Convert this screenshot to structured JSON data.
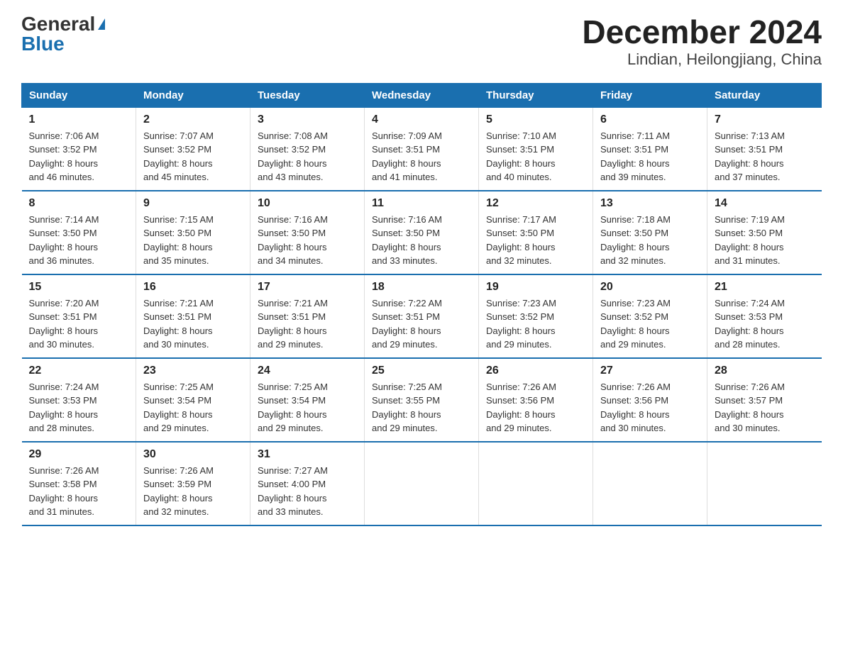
{
  "logo": {
    "general": "General",
    "blue": "Blue",
    "triangle": true
  },
  "title": "December 2024",
  "subtitle": "Lindian, Heilongjiang, China",
  "days_header": [
    "Sunday",
    "Monday",
    "Tuesday",
    "Wednesday",
    "Thursday",
    "Friday",
    "Saturday"
  ],
  "weeks": [
    [
      {
        "num": "1",
        "info": "Sunrise: 7:06 AM\nSunset: 3:52 PM\nDaylight: 8 hours\nand 46 minutes."
      },
      {
        "num": "2",
        "info": "Sunrise: 7:07 AM\nSunset: 3:52 PM\nDaylight: 8 hours\nand 45 minutes."
      },
      {
        "num": "3",
        "info": "Sunrise: 7:08 AM\nSunset: 3:52 PM\nDaylight: 8 hours\nand 43 minutes."
      },
      {
        "num": "4",
        "info": "Sunrise: 7:09 AM\nSunset: 3:51 PM\nDaylight: 8 hours\nand 41 minutes."
      },
      {
        "num": "5",
        "info": "Sunrise: 7:10 AM\nSunset: 3:51 PM\nDaylight: 8 hours\nand 40 minutes."
      },
      {
        "num": "6",
        "info": "Sunrise: 7:11 AM\nSunset: 3:51 PM\nDaylight: 8 hours\nand 39 minutes."
      },
      {
        "num": "7",
        "info": "Sunrise: 7:13 AM\nSunset: 3:51 PM\nDaylight: 8 hours\nand 37 minutes."
      }
    ],
    [
      {
        "num": "8",
        "info": "Sunrise: 7:14 AM\nSunset: 3:50 PM\nDaylight: 8 hours\nand 36 minutes."
      },
      {
        "num": "9",
        "info": "Sunrise: 7:15 AM\nSunset: 3:50 PM\nDaylight: 8 hours\nand 35 minutes."
      },
      {
        "num": "10",
        "info": "Sunrise: 7:16 AM\nSunset: 3:50 PM\nDaylight: 8 hours\nand 34 minutes."
      },
      {
        "num": "11",
        "info": "Sunrise: 7:16 AM\nSunset: 3:50 PM\nDaylight: 8 hours\nand 33 minutes."
      },
      {
        "num": "12",
        "info": "Sunrise: 7:17 AM\nSunset: 3:50 PM\nDaylight: 8 hours\nand 32 minutes."
      },
      {
        "num": "13",
        "info": "Sunrise: 7:18 AM\nSunset: 3:50 PM\nDaylight: 8 hours\nand 32 minutes."
      },
      {
        "num": "14",
        "info": "Sunrise: 7:19 AM\nSunset: 3:50 PM\nDaylight: 8 hours\nand 31 minutes."
      }
    ],
    [
      {
        "num": "15",
        "info": "Sunrise: 7:20 AM\nSunset: 3:51 PM\nDaylight: 8 hours\nand 30 minutes."
      },
      {
        "num": "16",
        "info": "Sunrise: 7:21 AM\nSunset: 3:51 PM\nDaylight: 8 hours\nand 30 minutes."
      },
      {
        "num": "17",
        "info": "Sunrise: 7:21 AM\nSunset: 3:51 PM\nDaylight: 8 hours\nand 29 minutes."
      },
      {
        "num": "18",
        "info": "Sunrise: 7:22 AM\nSunset: 3:51 PM\nDaylight: 8 hours\nand 29 minutes."
      },
      {
        "num": "19",
        "info": "Sunrise: 7:23 AM\nSunset: 3:52 PM\nDaylight: 8 hours\nand 29 minutes."
      },
      {
        "num": "20",
        "info": "Sunrise: 7:23 AM\nSunset: 3:52 PM\nDaylight: 8 hours\nand 29 minutes."
      },
      {
        "num": "21",
        "info": "Sunrise: 7:24 AM\nSunset: 3:53 PM\nDaylight: 8 hours\nand 28 minutes."
      }
    ],
    [
      {
        "num": "22",
        "info": "Sunrise: 7:24 AM\nSunset: 3:53 PM\nDaylight: 8 hours\nand 28 minutes."
      },
      {
        "num": "23",
        "info": "Sunrise: 7:25 AM\nSunset: 3:54 PM\nDaylight: 8 hours\nand 29 minutes."
      },
      {
        "num": "24",
        "info": "Sunrise: 7:25 AM\nSunset: 3:54 PM\nDaylight: 8 hours\nand 29 minutes."
      },
      {
        "num": "25",
        "info": "Sunrise: 7:25 AM\nSunset: 3:55 PM\nDaylight: 8 hours\nand 29 minutes."
      },
      {
        "num": "26",
        "info": "Sunrise: 7:26 AM\nSunset: 3:56 PM\nDaylight: 8 hours\nand 29 minutes."
      },
      {
        "num": "27",
        "info": "Sunrise: 7:26 AM\nSunset: 3:56 PM\nDaylight: 8 hours\nand 30 minutes."
      },
      {
        "num": "28",
        "info": "Sunrise: 7:26 AM\nSunset: 3:57 PM\nDaylight: 8 hours\nand 30 minutes."
      }
    ],
    [
      {
        "num": "29",
        "info": "Sunrise: 7:26 AM\nSunset: 3:58 PM\nDaylight: 8 hours\nand 31 minutes."
      },
      {
        "num": "30",
        "info": "Sunrise: 7:26 AM\nSunset: 3:59 PM\nDaylight: 8 hours\nand 32 minutes."
      },
      {
        "num": "31",
        "info": "Sunrise: 7:27 AM\nSunset: 4:00 PM\nDaylight: 8 hours\nand 33 minutes."
      },
      {
        "num": "",
        "info": ""
      },
      {
        "num": "",
        "info": ""
      },
      {
        "num": "",
        "info": ""
      },
      {
        "num": "",
        "info": ""
      }
    ]
  ]
}
